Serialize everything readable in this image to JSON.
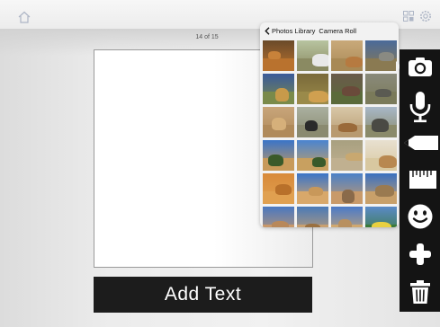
{
  "page_counter": "14 of 15",
  "add_text_label": "Add Text",
  "popover": {
    "back_label": "Photos Library",
    "title": "Camera Roll"
  },
  "photos": [
    {
      "sky": "#6a4a2a",
      "ground": "#b9722e",
      "animal": "#c8823a",
      "subject": "lion"
    },
    {
      "sky": "#b8c4a0",
      "ground": "#8a8a62",
      "animal": "#e8e8e8",
      "subject": "zebra"
    },
    {
      "sky": "#c9a97a",
      "ground": "#a88955",
      "animal": "#b67a40",
      "subject": "antelope"
    },
    {
      "sky": "#4a6a9a",
      "ground": "#8a7a52",
      "animal": "#8a8a82",
      "subject": "elephant"
    },
    {
      "sky": "#3a5a9a",
      "ground": "#7a8a4a",
      "animal": "#c89a4a",
      "subject": "giraffe"
    },
    {
      "sky": "#7a6a3a",
      "ground": "#9a8a4a",
      "animal": "#d0a050",
      "subject": "leopard"
    },
    {
      "sky": "#6a5a4a",
      "ground": "#5a6a3a",
      "animal": "#6a4a3a",
      "subject": "hippo"
    },
    {
      "sky": "#8a8a7a",
      "ground": "#7a7a5a",
      "animal": "#5a5a52",
      "subject": "rhino"
    },
    {
      "sky": "#c8a57a",
      "ground": "#b08a5a",
      "animal": "#d6b07a",
      "subject": "cheetah"
    },
    {
      "sky": "#aab0a0",
      "ground": "#8a8a70",
      "animal": "#2a2a2a",
      "subject": "buffalo"
    },
    {
      "sky": "#d8c8a8",
      "ground": "#b89a70",
      "animal": "#9a6a3a",
      "subject": "hyena"
    },
    {
      "sky": "#a8b8c8",
      "ground": "#8a8a6a",
      "animal": "#4a4a44",
      "subject": "wildebeest"
    },
    {
      "sky": "#3a74c8",
      "ground": "#c89a5a",
      "animal": "#3a5a2a",
      "subject": "acacia"
    },
    {
      "sky": "#4a84d0",
      "ground": "#c8a060",
      "animal": "#3a5a2a",
      "subject": "acacia"
    },
    {
      "sky": "#a8a080",
      "ground": "#c0b090",
      "animal": "#c8a870",
      "subject": "meerkat"
    },
    {
      "sky": "#e8e0d0",
      "ground": "#d8c8a0",
      "animal": "#b88850",
      "subject": "camel"
    },
    {
      "sky": "#d88a3a",
      "ground": "#e0a050",
      "animal": "#b8702a",
      "subject": "jackal"
    },
    {
      "sky": "#3a74c8",
      "ground": "#d8a86a",
      "animal": "#c8985a",
      "subject": "dunes"
    },
    {
      "sky": "#4a80c8",
      "ground": "#c89a6a",
      "animal": "#8a6a4a",
      "subject": "desert"
    },
    {
      "sky": "#3a70c0",
      "ground": "#c8a06a",
      "animal": "#9a7a50",
      "subject": "desert"
    },
    {
      "sky": "#4a78c0",
      "ground": "#c8986a",
      "animal": "#b8885a",
      "subject": "dunes"
    },
    {
      "sky": "#4a7ab8",
      "ground": "#c8a070",
      "animal": "#9a7040",
      "subject": "desert"
    },
    {
      "sky": "#4a7ac8",
      "ground": "#d0a870",
      "animal": "#b89060",
      "subject": "dunes"
    },
    {
      "sky": "#5a8ac8",
      "ground": "#3a7a3a",
      "animal": "#e8d040",
      "subject": "flag"
    }
  ],
  "toolbar": {
    "tools": [
      "camera-icon",
      "microphone-icon",
      "pencil-icon",
      "ruler-icon",
      "smiley-icon",
      "plus-icon",
      "trash-icon"
    ]
  },
  "colors": {
    "toolbar_bg": "#141414",
    "add_text_bg": "#1c1c1c",
    "icon_white": "#ffffff",
    "topbar_icon": "#b0b8c8"
  }
}
